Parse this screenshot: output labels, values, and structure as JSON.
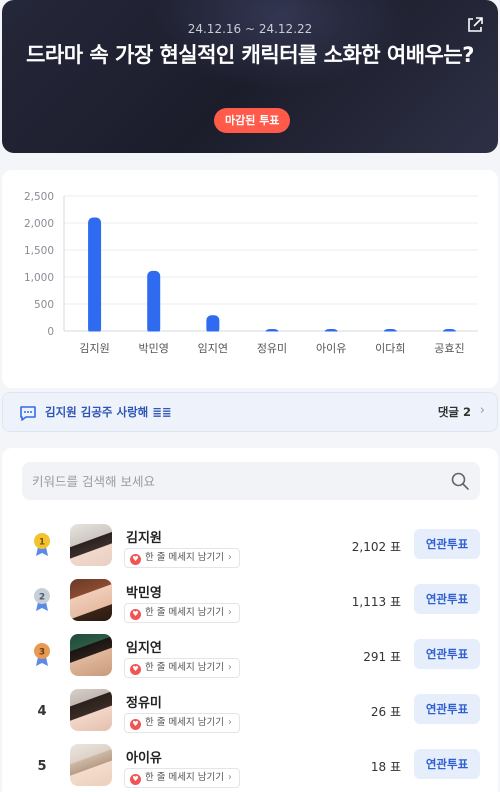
{
  "hero": {
    "date_range": "24.12.16 ~ 24.12.22",
    "title": "드라마 속 가장 현실적인 캐릭터를 소화한 여배우는?",
    "status_badge": "마감된 투표"
  },
  "chart_data": {
    "type": "bar",
    "categories": [
      "김지원",
      "박민영",
      "임지연",
      "정유미",
      "아이유",
      "이다희",
      "공효진"
    ],
    "values": [
      2102,
      1113,
      291,
      26,
      18,
      10,
      8
    ],
    "yticks": [
      "0",
      "500",
      "1,000",
      "1,500",
      "2,000",
      "2,500"
    ],
    "ylim": [
      0,
      2500
    ],
    "grid": true,
    "bar_color": "#2f6bf0"
  },
  "comment_bar": {
    "text": "김지원 김공주 사랑해 ≣≣",
    "count_label": "댓글 2"
  },
  "search": {
    "placeholder": "키워드를 검색해 보세요"
  },
  "rankings": [
    {
      "rank": "1",
      "medal": "gold",
      "name": "김지원",
      "message_label": "한 줄 메세지 남기기",
      "votes": "2,102 표",
      "button": "연관투표"
    },
    {
      "rank": "2",
      "medal": "silver",
      "name": "박민영",
      "message_label": "한 줄 메세지 남기기",
      "votes": "1,113 표",
      "button": "연관투표"
    },
    {
      "rank": "3",
      "medal": "bronze",
      "name": "임지연",
      "message_label": "한 줄 메세지 남기기",
      "votes": "291 표",
      "button": "연관투표"
    },
    {
      "rank": "4",
      "medal": "",
      "name": "정유미",
      "message_label": "한 줄 메세지 남기기",
      "votes": "26 표",
      "button": "연관투표"
    },
    {
      "rank": "5",
      "medal": "",
      "name": "아이유",
      "message_label": "한 줄 메세지 남기기",
      "votes": "18 표",
      "button": "연관투표"
    }
  ],
  "colors": {
    "accent": "#2f6bf0",
    "badge": "#ff5a4a",
    "gold": "#f2c230",
    "silver": "#b8c3cf",
    "bronze": "#e89a55"
  }
}
